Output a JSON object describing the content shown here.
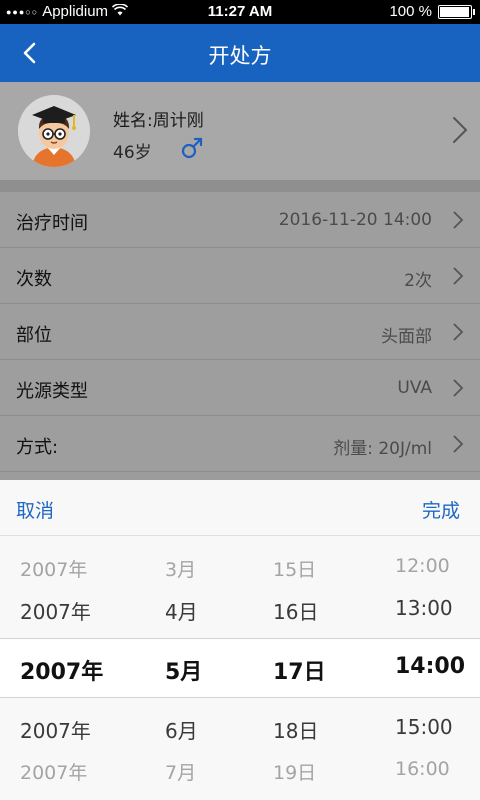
{
  "status": {
    "carrier": "Applidium",
    "time": "11:27 AM",
    "battery": "100 %",
    "battery_level": 1.0
  },
  "nav": {
    "title": "开处方"
  },
  "patient": {
    "name": "姓名:周计刚",
    "age": "46岁",
    "gender_symbol": "♂"
  },
  "rows": [
    {
      "label": "治疗时间",
      "value": "2016-11-20 14:00"
    },
    {
      "label": "次数",
      "value": "2次"
    },
    {
      "label": "部位",
      "value": "头面部"
    },
    {
      "label": "光源类型",
      "value": "UVA"
    },
    {
      "label": "方式:",
      "value": "剂量: 20J/ml"
    }
  ],
  "sheet": {
    "cancel": "取消",
    "done": "完成"
  },
  "picker": {
    "rows": [
      [
        "2007年",
        "3月",
        "15日",
        "12:00"
      ],
      [
        "2007年",
        "4月",
        "16日",
        "13:00"
      ],
      [
        "2007年",
        "5月",
        "17日",
        "14:00"
      ],
      [
        "2007年",
        "6月",
        "18日",
        "15:00"
      ],
      [
        "2007年",
        "7月",
        "19日",
        "16:00"
      ]
    ],
    "selected_index": 2
  }
}
